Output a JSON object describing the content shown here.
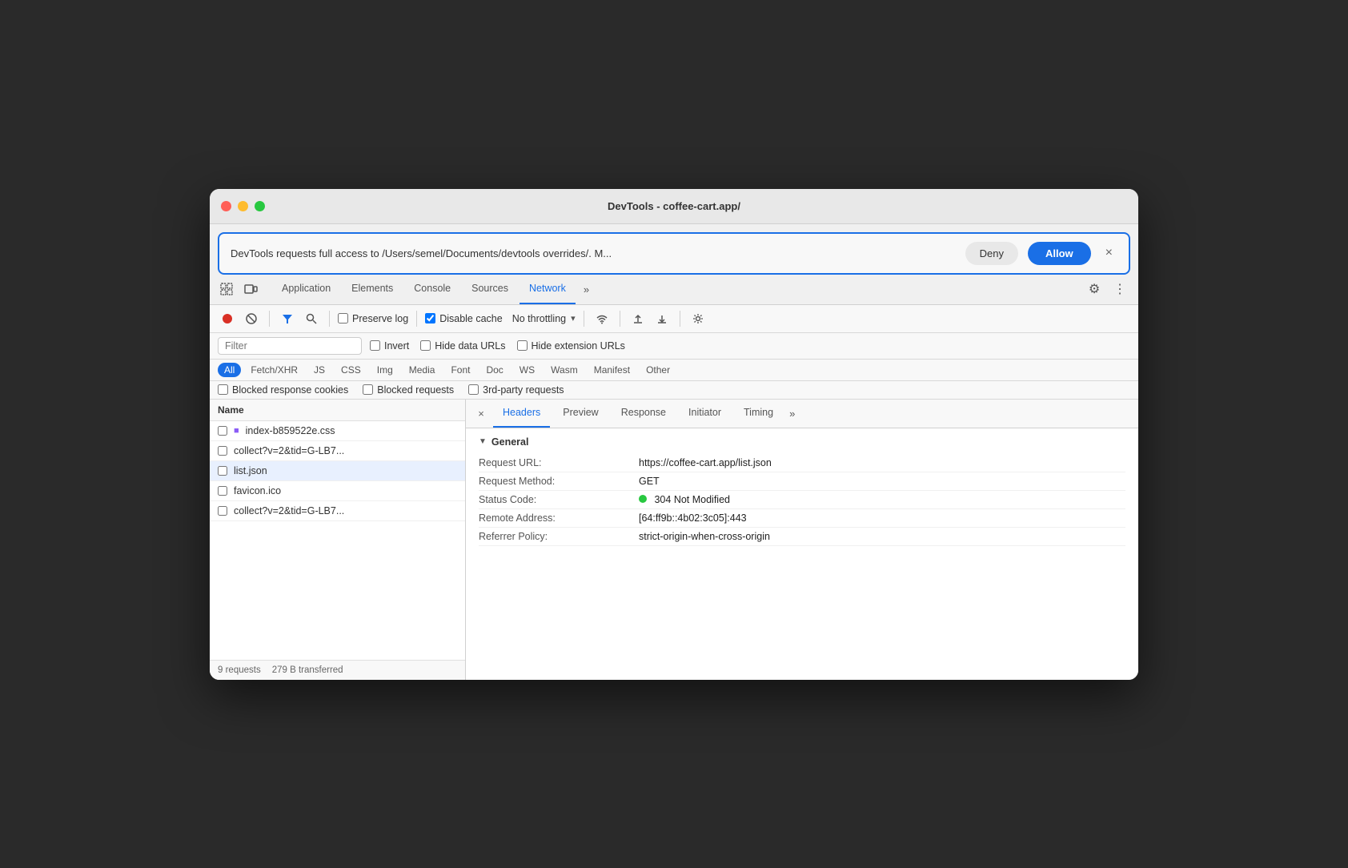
{
  "window": {
    "title": "DevTools - coffee-cart.app/"
  },
  "traffic_lights": {
    "close": "close",
    "minimize": "minimize",
    "maximize": "maximize"
  },
  "permission_bar": {
    "text": "DevTools requests full access to /Users/semel/Documents/devtools overrides/. M...",
    "deny_label": "Deny",
    "allow_label": "Allow",
    "close_symbol": "×"
  },
  "tabs": {
    "items": [
      {
        "label": "Application",
        "active": false
      },
      {
        "label": "Elements",
        "active": false
      },
      {
        "label": "Console",
        "active": false
      },
      {
        "label": "Sources",
        "active": false
      },
      {
        "label": "Network",
        "active": true
      }
    ],
    "overflow": "»",
    "settings_symbol": "⚙",
    "more_symbol": "⋮"
  },
  "network_toolbar": {
    "stop_symbol": "⏺",
    "clear_symbol": "🚫",
    "filter_symbol": "▼",
    "search_symbol": "🔍",
    "preserve_log_label": "Preserve log",
    "disable_cache_label": "Disable cache",
    "throttling_label": "No throttling",
    "throttle_arrow": "▾",
    "wifi_symbol": "WiFi",
    "upload_symbol": "↑",
    "download_symbol": "↓",
    "settings_symbol": "⚙"
  },
  "filter_bar": {
    "placeholder": "Filter",
    "invert_label": "Invert",
    "hide_data_urls_label": "Hide data URLs",
    "hide_extension_urls_label": "Hide extension URLs"
  },
  "type_filter": {
    "buttons": [
      {
        "label": "All",
        "active": true
      },
      {
        "label": "Fetch/XHR",
        "active": false
      },
      {
        "label": "JS",
        "active": false
      },
      {
        "label": "CSS",
        "active": false
      },
      {
        "label": "Img",
        "active": false
      },
      {
        "label": "Media",
        "active": false
      },
      {
        "label": "Font",
        "active": false
      },
      {
        "label": "Doc",
        "active": false
      },
      {
        "label": "WS",
        "active": false
      },
      {
        "label": "Wasm",
        "active": false
      },
      {
        "label": "Manifest",
        "active": false
      },
      {
        "label": "Other",
        "active": false
      }
    ]
  },
  "blocked_bar": {
    "blocked_cookies_label": "Blocked response cookies",
    "blocked_requests_label": "Blocked requests",
    "third_party_label": "3rd-party requests"
  },
  "file_list": {
    "header": "Name",
    "items": [
      {
        "name": "index-b859522e.css",
        "checked": false,
        "has_icon": true
      },
      {
        "name": "collect?v=2&tid=G-LB7...",
        "checked": false,
        "has_icon": false
      },
      {
        "name": "list.json",
        "checked": false,
        "has_icon": false,
        "selected": true
      },
      {
        "name": "favicon.ico",
        "checked": false,
        "has_icon": false
      },
      {
        "name": "collect?v=2&tid=G-LB7...",
        "checked": false,
        "has_icon": false
      }
    ],
    "footer": {
      "requests": "9 requests",
      "transferred": "279 B transferred"
    }
  },
  "detail_panel": {
    "tabs": [
      {
        "label": "Headers",
        "active": true
      },
      {
        "label": "Preview",
        "active": false
      },
      {
        "label": "Response",
        "active": false
      },
      {
        "label": "Initiator",
        "active": false
      },
      {
        "label": "Timing",
        "active": false
      }
    ],
    "overflow": "»",
    "close_symbol": "×",
    "general_section": {
      "title": "General",
      "rows": [
        {
          "key": "Request URL:",
          "value": "https://coffee-cart.app/list.json"
        },
        {
          "key": "Request Method:",
          "value": "GET"
        },
        {
          "key": "Status Code:",
          "value": "304 Not Modified",
          "has_dot": true
        },
        {
          "key": "Remote Address:",
          "value": "[64:ff9b::4b02:3c05]:443"
        },
        {
          "key": "Referrer Policy:",
          "value": "strict-origin-when-cross-origin"
        }
      ]
    }
  }
}
